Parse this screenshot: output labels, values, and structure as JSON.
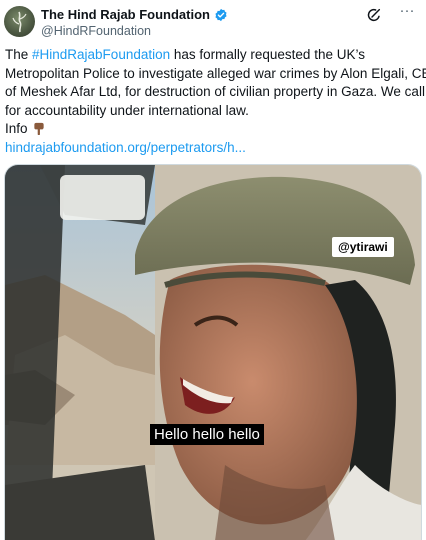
{
  "tweet": {
    "author": {
      "display_name": "The Hind Rajab Foundation",
      "handle": "@HindRFoundation",
      "verified": true,
      "avatar_icon": "foundation-logo-avatar"
    },
    "actions": {
      "grok_icon": "grok-icon",
      "more_label": "···"
    },
    "text": {
      "line1_pre": "The ",
      "hashtag": "#HindRajabFoundation",
      "line1_post": " has formally requested the UK’s",
      "line2": "Metropolitan Police to investigate alleged war crimes by Alon Elgali, CEO",
      "line3": "of Meshek Afar Ltd, for destruction of civilian property in Gaza. We call",
      "line4": "for accountability under international law.",
      "line5": "Info",
      "emoji_icon": "pointing-down-emoji-icon",
      "link": "hindrajabfoundation.org/perpetrators/h..."
    },
    "media": {
      "type": "video",
      "watermark": "@ytirawi",
      "caption": "Hello hello hello"
    },
    "colors": {
      "link": "#1d9bf0",
      "verified": "#1d9bf0",
      "text": "#0f1419",
      "secondary": "#536471"
    }
  }
}
